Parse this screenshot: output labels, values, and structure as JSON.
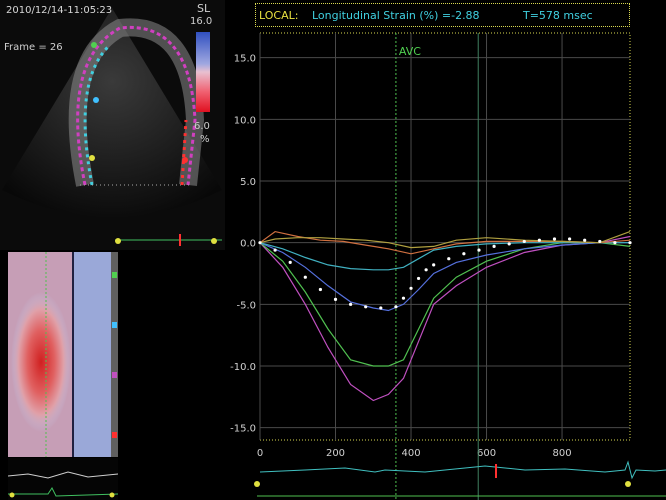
{
  "echo_view": {
    "timestamp": "2010/12/14-11:05:23",
    "frame_label": "Frame = 26",
    "colorbar_label": "SL",
    "colorbar_max": "16.0",
    "colorbar_min": "6.0",
    "colorbar_unit": "%"
  },
  "header": {
    "mode": "LOCAL:",
    "parameter": "Longitudinal Strain (%) =-2.88",
    "time": "T=578 msec"
  },
  "chart_data": {
    "type": "line",
    "xlim": [
      0,
      980
    ],
    "ylim": [
      -16,
      17
    ],
    "yticks": [
      15.0,
      10.0,
      5.0,
      0.0,
      -5.0,
      -10.0,
      -15.0
    ],
    "ytick_labels": [
      "15.0",
      "10.0",
      "5.0",
      "0.0",
      "-5.0",
      "-10.0",
      "-15.0"
    ],
    "xticks": [
      0,
      200,
      400,
      600,
      800
    ],
    "xtick_labels": [
      "0",
      "200",
      "400",
      "600",
      "800"
    ],
    "grid": true,
    "markers": [
      {
        "label": "AVC",
        "x": 360
      },
      {
        "label": "",
        "x": 578
      }
    ],
    "series": [
      {
        "color": "#c050c0",
        "x": [
          0,
          60,
          120,
          180,
          240,
          300,
          340,
          380,
          420,
          460,
          520,
          600,
          700,
          800,
          900,
          980
        ],
        "y": [
          0,
          -2,
          -5,
          -8.5,
          -11.5,
          -12.8,
          -12.3,
          -11,
          -8,
          -5,
          -3.5,
          -2,
          -0.8,
          -0.2,
          0,
          0.5
        ]
      },
      {
        "color": "#50c050",
        "x": [
          0,
          60,
          120,
          180,
          240,
          300,
          340,
          380,
          420,
          460,
          520,
          600,
          700,
          800,
          900,
          980
        ],
        "y": [
          0,
          -1.5,
          -4,
          -7,
          -9.5,
          -10,
          -10,
          -9.5,
          -7,
          -4.5,
          -2.8,
          -1.5,
          -0.5,
          0,
          0,
          -0.3
        ]
      },
      {
        "color": "#5570dd",
        "x": [
          0,
          60,
          120,
          180,
          240,
          300,
          340,
          380,
          420,
          460,
          520,
          600,
          700,
          800,
          900,
          980
        ],
        "y": [
          0,
          -0.8,
          -2,
          -3.5,
          -4.8,
          -5.3,
          -5.5,
          -5,
          -3.8,
          -2.5,
          -1.6,
          -1,
          -0.5,
          -0.2,
          0,
          0
        ]
      },
      {
        "color": "#40b0c0",
        "x": [
          0,
          60,
          120,
          180,
          240,
          300,
          340,
          380,
          420,
          460,
          520,
          600,
          700,
          800,
          900,
          980
        ],
        "y": [
          0,
          -0.5,
          -1.2,
          -1.8,
          -2.1,
          -2.2,
          -2.2,
          -2,
          -1.3,
          -0.6,
          -0.3,
          -0.1,
          0,
          0,
          0,
          0
        ]
      },
      {
        "color": "#d07040",
        "x": [
          0,
          40,
          100,
          160,
          220,
          280,
          340,
          400,
          460,
          520,
          600,
          700,
          800,
          900,
          980
        ],
        "y": [
          0,
          0.9,
          0.5,
          0.2,
          0.1,
          -0.2,
          -0.5,
          -0.9,
          -0.5,
          -0.1,
          0.1,
          0.1,
          0.1,
          0,
          0.2
        ]
      },
      {
        "color": "#b0a040",
        "x": [
          0,
          40,
          100,
          160,
          220,
          280,
          340,
          400,
          460,
          520,
          600,
          700,
          800,
          900,
          980
        ],
        "y": [
          0,
          0.3,
          0.4,
          0.4,
          0.3,
          0.2,
          0,
          -0.4,
          -0.3,
          0.2,
          0.4,
          0.2,
          0.1,
          0,
          0.9
        ]
      },
      {
        "color": "#ffffff",
        "dotted": true,
        "x": [
          0,
          40,
          80,
          120,
          160,
          200,
          240,
          280,
          320,
          360,
          380,
          400,
          420,
          440,
          460,
          500,
          540,
          580,
          620,
          660,
          700,
          740,
          780,
          820,
          860,
          900,
          940,
          980
        ],
        "y": [
          0,
          -0.6,
          -1.6,
          -2.8,
          -3.8,
          -4.6,
          -5.0,
          -5.2,
          -5.3,
          -5.2,
          -4.5,
          -3.7,
          -2.9,
          -2.2,
          -1.8,
          -1.3,
          -0.9,
          -0.6,
          -0.3,
          -0.1,
          0.1,
          0.2,
          0.3,
          0.3,
          0.2,
          0.1,
          0,
          0
        ]
      }
    ]
  }
}
